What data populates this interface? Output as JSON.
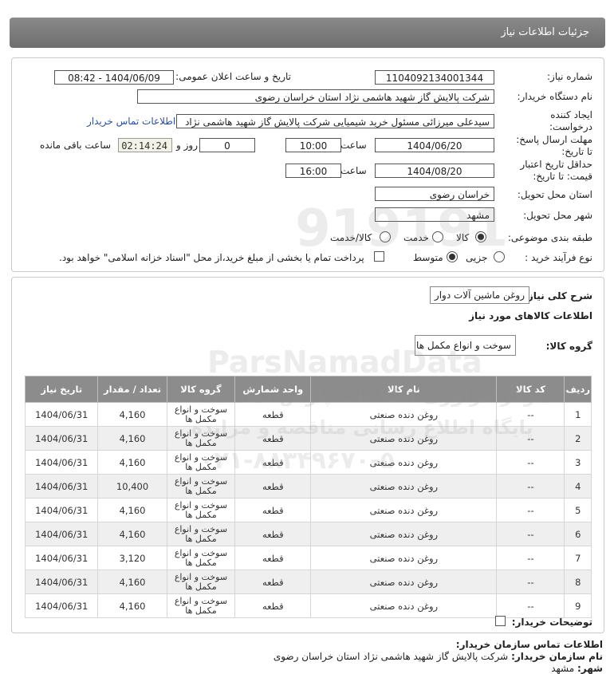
{
  "header": {
    "title": "جزئیات اطلاعات نیاز"
  },
  "form": {
    "need_number_label": "شماره نیاز:",
    "need_number": "1104092134001344",
    "announce_label": "تاریخ و ساعت اعلان عمومی:",
    "announce_value": "1404/06/09 - 08:42",
    "buyer_label": "نام دستگاه خریدار:",
    "buyer_value": "شرکت پالایش گاز شهید هاشمی نژاد   استان خراسان رضوی",
    "creator_label": "ایجاد کننده درخواست:",
    "creator_value": "سیدعلی میرزائی مسئول خرید شیمیایی شرکت پالایش گاز شهید هاشمی نژاد",
    "contact_link": "اطلاعات تماس خریدار",
    "deadline_label": "مهلت ارسال پاسخ: تا تاریخ:",
    "deadline_date": "1404/06/20",
    "time_label": "ساعت",
    "deadline_time": "10:00",
    "days_value": "0",
    "days_label": "روز و",
    "remaining_time": "02:14:24",
    "remaining_label": "ساعت باقی مانده",
    "validity_label": "حداقل تاریخ اعتبار قیمت: تا تاریخ:",
    "validity_date": "1404/08/20",
    "validity_time": "16:00",
    "province_label": "استان محل تحویل:",
    "province_value": "خراسان رضوی",
    "city_label": "شهر محل تحویل:",
    "city_value": "مشهد",
    "category_label": "طبقه بندی موضوعی:",
    "category_options": [
      "کالا",
      "خدمت",
      "کالا/خدمت"
    ],
    "category_selected": "کالا",
    "process_label": "نوع فرآیند خرید :",
    "process_options": [
      "جزیی",
      "متوسط"
    ],
    "process_selected": "متوسط",
    "payment_note": "پرداخت تمام یا بخشی از مبلغ خرید،از محل \"اسناد خزانه اسلامی\" خواهد بود."
  },
  "details": {
    "summary_label": "شرح کلی نیاز:",
    "summary_value": "روغن ماشین آلات دوار",
    "items_title": "اطلاعات کالاهای مورد نیاز",
    "group_label": "گروه کالا:",
    "group_value": "سوخت و انواع مکمل ها",
    "columns": [
      "ردیف",
      "کد کالا",
      "نام کالا",
      "واحد شمارش",
      "گروه کالا",
      "تعداد / مقدار",
      "تاریخ نیاز"
    ],
    "rows": [
      {
        "idx": "1",
        "code": "--",
        "name": "روغن دنده صنعتی",
        "unit": "قطعه",
        "group": "سوخت و انواع مکمل ها",
        "qty": "4,160",
        "date": "1404/06/31"
      },
      {
        "idx": "2",
        "code": "--",
        "name": "روغن دنده صنعتی",
        "unit": "قطعه",
        "group": "سوخت و انواع مکمل ها",
        "qty": "4,160",
        "date": "1404/06/31"
      },
      {
        "idx": "3",
        "code": "--",
        "name": "روغن دنده صنعتی",
        "unit": "قطعه",
        "group": "سوخت و انواع مکمل ها",
        "qty": "4,160",
        "date": "1404/06/31"
      },
      {
        "idx": "4",
        "code": "--",
        "name": "روغن دنده صنعتی",
        "unit": "قطعه",
        "group": "سوخت و انواع مکمل ها",
        "qty": "10,400",
        "date": "1404/06/31"
      },
      {
        "idx": "5",
        "code": "--",
        "name": "روغن دنده صنعتی",
        "unit": "قطعه",
        "group": "سوخت و انواع مکمل ها",
        "qty": "4,160",
        "date": "1404/06/31"
      },
      {
        "idx": "6",
        "code": "--",
        "name": "روغن دنده صنعتی",
        "unit": "قطعه",
        "group": "سوخت و انواع مکمل ها",
        "qty": "4,160",
        "date": "1404/06/31"
      },
      {
        "idx": "7",
        "code": "--",
        "name": "روغن دنده صنعتی",
        "unit": "قطعه",
        "group": "سوخت و انواع مکمل ها",
        "qty": "3,120",
        "date": "1404/06/31"
      },
      {
        "idx": "8",
        "code": "--",
        "name": "روغن دنده صنعتی",
        "unit": "قطعه",
        "group": "سوخت و انواع مکمل ها",
        "qty": "4,160",
        "date": "1404/06/31"
      },
      {
        "idx": "9",
        "code": "--",
        "name": "روغن دنده صنعتی",
        "unit": "قطعه",
        "group": "سوخت و انواع مکمل ها",
        "qty": "4,160",
        "date": "1404/06/31"
      }
    ],
    "buyer_notes_label": "توضیحات خریدار:"
  },
  "footer": {
    "contact_title": "اطلاعات تماس سازمان خریدار:",
    "org_label": "نام سازمان خریدار:",
    "org_value": "شرکت پالایش گاز شهید هاشمی نژاد استان خراسان رضوی",
    "city_label": "شهر:",
    "city_value": "مشهد"
  },
  "watermark": {
    "number": "919191",
    "brand": "ParsNamadData",
    "line1": "مرکز فراوری اطلاعات پارس نماد داده",
    "line2": "پایگاه اطلاع رسانی مناقصه و مزایده",
    "phone": "۰۲۱-۸۸۳۴۹۶۷۰-۵"
  }
}
